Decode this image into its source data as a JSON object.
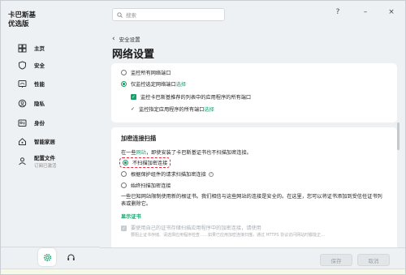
{
  "app": {
    "brand_line1": "卡巴斯基",
    "brand_line2": "优选版"
  },
  "sidebar": {
    "items": [
      {
        "label": "主页",
        "icon": "home-icon"
      },
      {
        "label": "安全",
        "icon": "shield-icon"
      },
      {
        "label": "性能",
        "icon": "speedometer-icon"
      },
      {
        "label": "隐私",
        "icon": "privacy-icon"
      },
      {
        "label": "身份",
        "icon": "identity-icon"
      },
      {
        "label": "智能家居",
        "icon": "smart-home-icon"
      },
      {
        "label": "配置文件",
        "sub": "订阅已激活",
        "icon": "profile-icon"
      }
    ]
  },
  "search": {
    "placeholder": "搜索"
  },
  "window_controls": {
    "help": "?",
    "minimize": "–",
    "close": "×"
  },
  "breadcrumb": {
    "back_label": "安全设置"
  },
  "page": {
    "title": "网络设置"
  },
  "ports_card": {
    "opt_all": "监控所有网络端口",
    "opt_selected_prefix": "仅监控选定网络端口",
    "opt_selected_link": "选择",
    "cb_kaspersky": "监控卡巴斯基推荐的列表中的应用程序的所有端口",
    "cb_apps_prefix": "监控指定应用程序的所有端口",
    "cb_apps_link": "选择"
  },
  "encrypted_card": {
    "heading": "加密连接扫描",
    "desc_prefix": "在一些",
    "desc_link": "网站",
    "desc_suffix": "，即使安装了卡巴斯基证书也不扫描加密连接。",
    "opt_none": "不扫描加密连接",
    "opt_request": "根据保护组件的请求扫描加密连接",
    "opt_always": "始终扫描加密连接",
    "warning": "一些已知网站限制使用新的根证书。我们相信与这些网站的连接是安全的。在这里，您可以将证书添加到受信任证书列表或删除它。",
    "show_cert": "显示证书",
    "cb_blocked_line1": "要使用自己的证书存储扫描应用程序中的加密连接，请使用",
    "cb_blocked_line2": "要阻止证书存储、请选择应用程序检查……如果已应用加密连接扫描，通过 HTTPS 协议访问网站时都能正..."
  },
  "footer": {
    "save_label": "保存",
    "cancel_label": "取消"
  },
  "colors": {
    "accent": "#1a9e6a",
    "highlight": "#e0283c"
  }
}
